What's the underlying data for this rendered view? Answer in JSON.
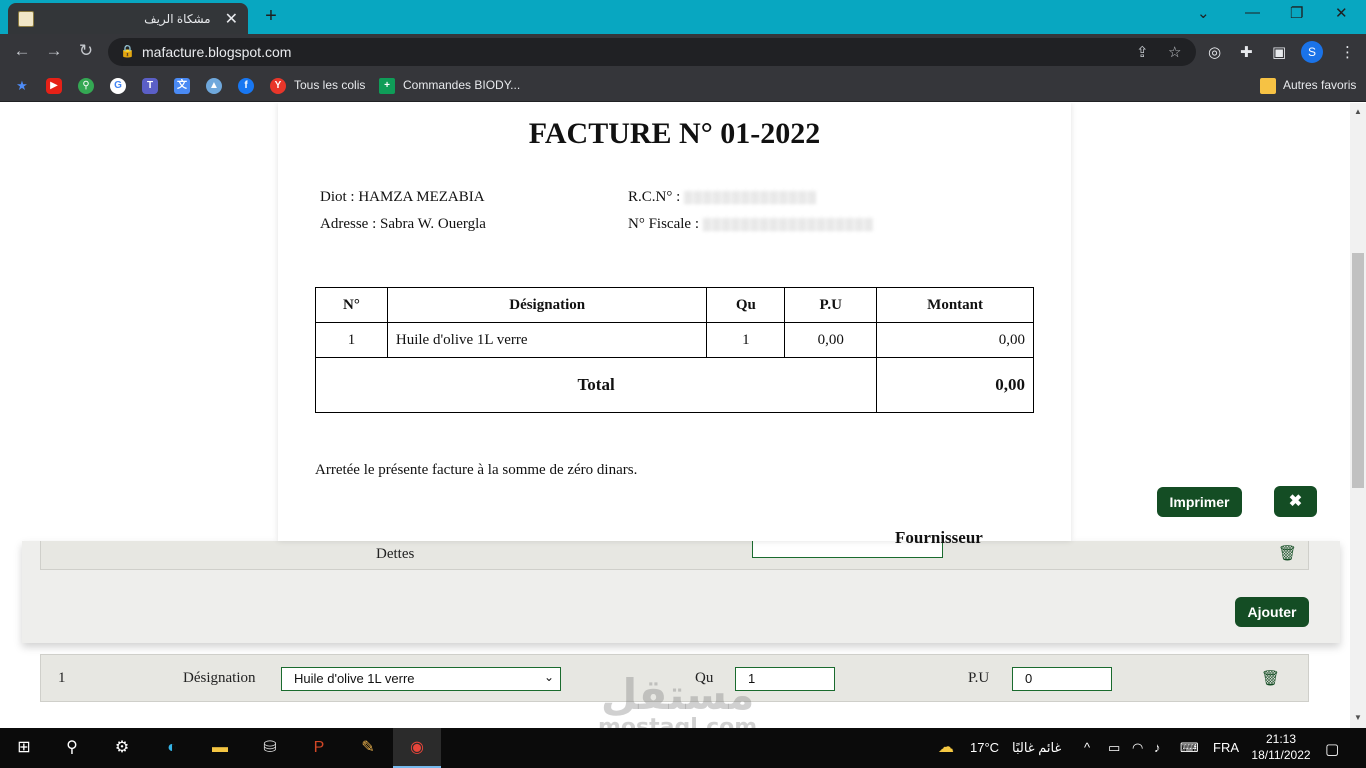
{
  "browser": {
    "tab_title": "مشكاة الريف",
    "url": "mafacture.blogspot.com",
    "profile_initial": "S",
    "bookmarks": {
      "colis": "Tous les colis",
      "biody": "Commandes BIODY...",
      "autres": "Autres favoris"
    }
  },
  "invoice": {
    "title": "FACTURE N° 01-2022",
    "client_name_label": "Diot : HAMZA MEZABIA",
    "client_address": "Adresse : Sabra W. Ouergla",
    "rcn_label": "R.C.N° :",
    "fiscal_label": "N° Fiscale :",
    "table": {
      "headers": [
        "N°",
        "Désignation",
        "Qu",
        "P.U",
        "Montant"
      ],
      "rows": [
        {
          "num": "1",
          "designation": "Huile d'olive 1L verre",
          "qu": "1",
          "pu": "0,00",
          "montant": "0,00"
        }
      ],
      "total_label": "Total",
      "total_value": "0,00"
    },
    "arretee": "Arretée le présente facture à la somme de zéro dinars.",
    "fournisseur": "Fournisseur"
  },
  "actions": {
    "print_label": "Imprimer",
    "close_label": "✖",
    "add_label": "Ajouter"
  },
  "form": {
    "dettes_label": "Dettes",
    "item": {
      "num": "1",
      "designation_label": "Désignation",
      "designation_value": "Huile d'olive 1L verre",
      "qu_label": "Qu",
      "qu_value": "1",
      "pu_label": "P.U",
      "pu_value": "0"
    }
  },
  "watermark": {
    "arabic": "مستقل",
    "latin": "mostaql.com"
  },
  "taskbar": {
    "temperature": "17°C",
    "weather": "غائم غالبًا",
    "language": "FRA",
    "time": "21:13",
    "date": "18/11/2022"
  }
}
